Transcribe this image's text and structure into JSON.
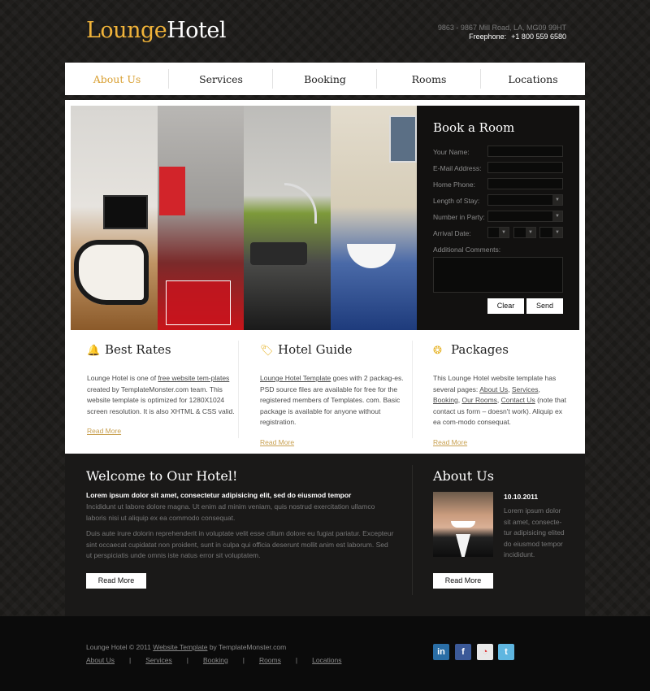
{
  "header": {
    "logo_part1": "Lounge",
    "logo_part2": "Hotel",
    "address": "9863 - 9867 Mill Road, LA, MG09 99HT",
    "phone_label": "Freephone:",
    "phone_number": "+1 800 559 6580"
  },
  "nav": {
    "items": [
      {
        "label": "About Us",
        "active": true
      },
      {
        "label": "Services",
        "active": false
      },
      {
        "label": "Booking",
        "active": false
      },
      {
        "label": "Rooms",
        "active": false
      },
      {
        "label": "Locations",
        "active": false
      }
    ]
  },
  "booking": {
    "title": "Book a Room",
    "fields": [
      {
        "label": "Your Name:"
      },
      {
        "label": "E-Mail Address:"
      },
      {
        "label": "Home Phone:"
      },
      {
        "label": "Length of Stay:"
      },
      {
        "label": "Number in Party:"
      },
      {
        "label": "Arrival Date:"
      }
    ],
    "comments_label": "Additional Comments:",
    "clear_label": "Clear",
    "send_label": "Send"
  },
  "features": [
    {
      "title": "Best Rates",
      "icon": "bell-icon",
      "text_prefix": "Lounge Hotel is one of ",
      "link": "free website tem-plates",
      "text_suffix": " created by TemplateMonster.com team. This website template is optimized for 1280X1024 screen resolution. It is also XHTML & CSS valid.",
      "more": "Read More"
    },
    {
      "title": "Hotel Guide",
      "icon": "tag-icon",
      "link": "Lounge Hotel Template",
      "text_suffix": " goes with 2 packag-es. PSD source files are available for free for the registered members of Templates. com. Basic package is available for anyone without registration.",
      "more": "Read More"
    },
    {
      "title": "Packages",
      "icon": "coins-icon",
      "text_prefix": "This Lounge Hotel website template has several pages: ",
      "links": [
        "About Us",
        "Services",
        "Booking",
        "Our Rooms",
        "Contact Us"
      ],
      "text_suffix": " (note that contact us form – doesn't work). Aliquip ex ea com-modo consequat.",
      "more": "Read More"
    }
  ],
  "welcome": {
    "title": "Welcome to Our Hotel!",
    "lead": "Lorem ipsum dolor sit amet, consectetur adipisicing elit, sed do eiusmod tempor",
    "p1": "Incididunt ut labore dolore magna. Ut enim ad minim veniam, quis nostrud exercitation ullamco laboris nisi ut aliquip ex ea commodo consequat.",
    "p2": "Duis aute irure dolorin reprehenderit in voluptate velit esse cillum dolore eu fugiat pariatur. Excepteur sint occaecat cupidatat non proident, sunt in culpa qui officia deserunt mollit anim est laborum. Sed ut perspiciatis unde omnis iste natus error sit voluptatem.",
    "button": "Read More"
  },
  "about": {
    "title": "About Us",
    "date": "10.10.2011",
    "text": "Lorem ipsum dolor sit amet, consecte-tur adipisicing elited do eiusmod tempor incididunt.",
    "button": "Read More"
  },
  "footer": {
    "copy_prefix": "Lounge Hotel © 2011 ",
    "copy_link": "Website Template",
    "copy_suffix": " by TemplateMonster.com",
    "nav": [
      "About Us",
      "Services",
      "Booking",
      "Rooms",
      "Locations"
    ],
    "separator": "|",
    "social": [
      {
        "name": "linkedin-icon",
        "glyph": "in",
        "color": "#2a6ea6"
      },
      {
        "name": "facebook-icon",
        "glyph": "f",
        "color": "#3b5998"
      },
      {
        "name": "picasa-icon",
        "glyph": "◔",
        "color": "#e8e8e8"
      },
      {
        "name": "twitter-icon",
        "glyph": "t",
        "color": "#5fb6e0"
      }
    ]
  },
  "colors": {
    "accent": "#f0b33a",
    "link_gold": "#c8a050"
  }
}
